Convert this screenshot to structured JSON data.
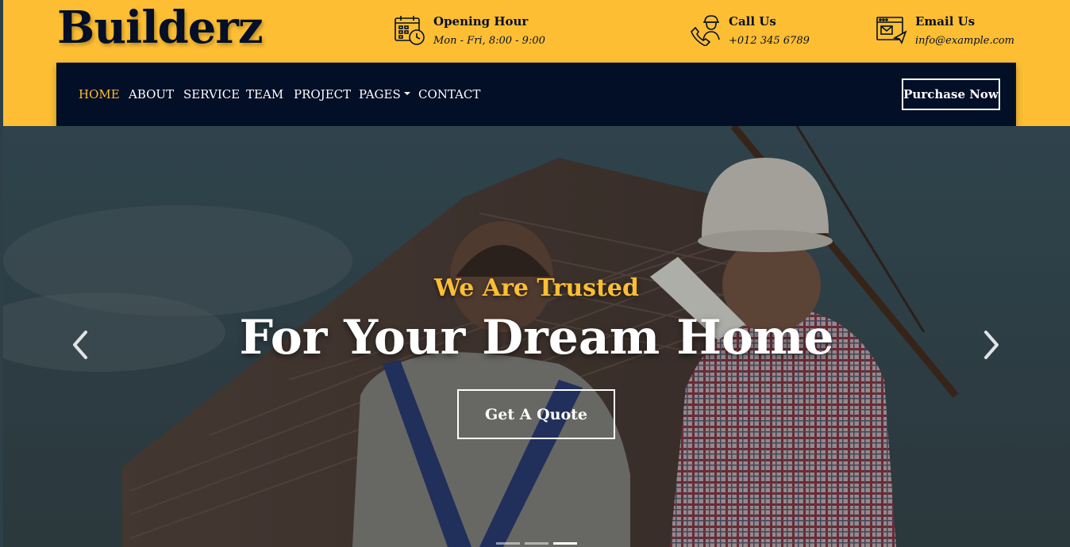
{
  "brand": {
    "logo": "Builderz"
  },
  "header_info": {
    "hours": {
      "title": "Opening Hour",
      "detail": "Mon - Fri, 8:00 - 9:00",
      "icon": "calendar-clock-icon"
    },
    "call": {
      "title": "Call Us",
      "detail": "+012 345 6789",
      "icon": "worker-phone-icon"
    },
    "email": {
      "title": "Email Us",
      "detail": "info@example.com",
      "icon": "mail-window-icon"
    }
  },
  "nav": {
    "items": [
      {
        "label": "HOME",
        "active": true
      },
      {
        "label": "ABOUT"
      },
      {
        "label": "SERVICE"
      },
      {
        "label": "TEAM"
      },
      {
        "label": "PROJECT"
      },
      {
        "label": "PAGES",
        "dropdown": true
      },
      {
        "label": "CONTACT"
      }
    ],
    "cta_label": "Purchase Now"
  },
  "hero": {
    "subtitle": "We Are Trusted",
    "title": "For Your Dream Home",
    "button_label": "Get A Quote",
    "slides_total": 3,
    "active_slide": 3
  },
  "colors": {
    "accent": "#fdbe33",
    "navy": "#030f27",
    "white": "#ffffff"
  }
}
